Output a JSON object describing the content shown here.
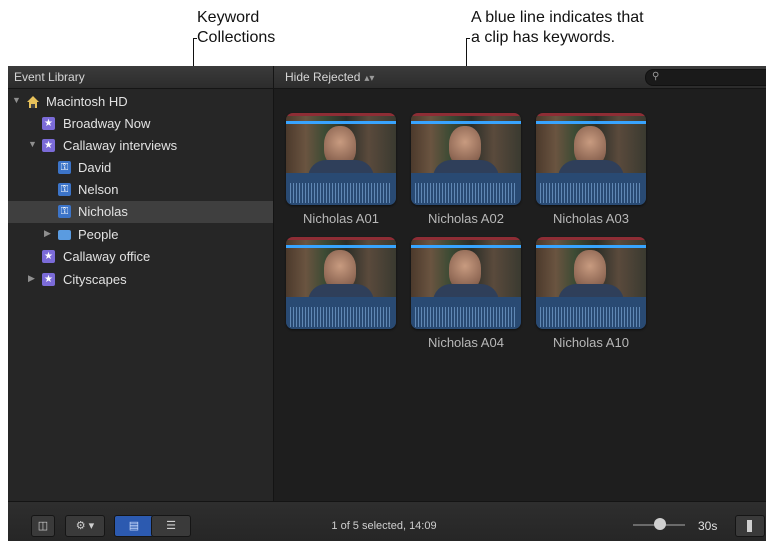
{
  "callouts": {
    "keyword_collections": [
      "Keyword",
      "Collections"
    ],
    "blue_line": [
      "A blue line indicates that",
      "a clip has keywords."
    ]
  },
  "header": {
    "library_title": "Event Library",
    "filter_label": "Hide Rejected",
    "filter_arrows": "▴▾",
    "search_icon": "search-icon"
  },
  "sidebar": {
    "items": [
      {
        "label": "Macintosh HD",
        "icon": "hard-drive-icon",
        "disclosure": "▼"
      },
      {
        "label": "Broadway Now",
        "icon": "event-star-icon"
      },
      {
        "label": "Callaway interviews",
        "icon": "event-star-icon",
        "disclosure": "▼"
      },
      {
        "label": "David",
        "icon": "keyword-icon"
      },
      {
        "label": "Nelson",
        "icon": "keyword-icon"
      },
      {
        "label": "Nicholas",
        "icon": "keyword-icon",
        "selected": true
      },
      {
        "label": "People",
        "icon": "folder-icon",
        "disclosure": "▶"
      },
      {
        "label": "Callaway office",
        "icon": "event-star-icon"
      },
      {
        "label": "Cityscapes",
        "icon": "event-star-icon",
        "disclosure": "▶"
      }
    ]
  },
  "browser": {
    "clips": [
      {
        "label": "Nicholas A01"
      },
      {
        "label": "Nicholas A02"
      },
      {
        "label": "Nicholas A03"
      },
      {
        "label": ""
      },
      {
        "label": "Nicholas A04"
      },
      {
        "label": "Nicholas A10"
      }
    ]
  },
  "toolbar": {
    "status": "1 of 5 selected, 14:09",
    "duration": "30s"
  },
  "colors": {
    "keyword_line": "#38a4ff",
    "rejected_bar": "#8e2d35",
    "audio_bg": "#294a73",
    "star_icon": "#7b6bd8",
    "keyword_icon": "#3c74c8",
    "active_view": "#2c5ab0"
  }
}
